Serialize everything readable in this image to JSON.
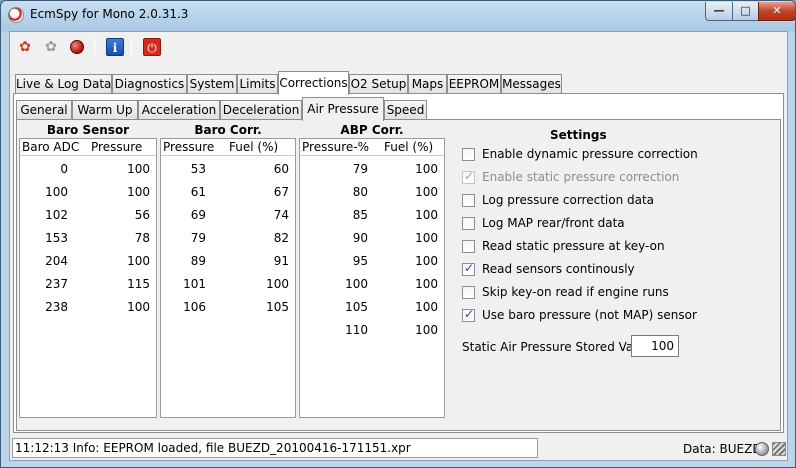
{
  "window": {
    "title": "EcmSpy for Mono 2.0.31.3"
  },
  "toolbar": {
    "buttons": [
      {
        "name": "connect-icon"
      },
      {
        "name": "disconnect-icon"
      },
      {
        "name": "stop-icon"
      },
      {
        "name": "info-icon",
        "glyph": "i"
      },
      {
        "name": "power-icon",
        "glyph": "⏻"
      }
    ]
  },
  "main_tabs": [
    "Live & Log Data",
    "Diagnostics",
    "System",
    "Limits",
    "Corrections",
    "O2 Setup",
    "Maps",
    "EEPROM",
    "Messages"
  ],
  "main_tab_active": "Corrections",
  "sub_tabs": [
    "General",
    "Warm Up",
    "Acceleration",
    "Deceleration",
    "Air Pressure",
    "Speed"
  ],
  "sub_tab_active": "Air Pressure",
  "baro_sensor": {
    "title": "Baro Sensor",
    "col1": "Baro ADC",
    "col2": "Pressure",
    "rows": [
      [
        "0",
        "100"
      ],
      [
        "100",
        "100"
      ],
      [
        "102",
        "56"
      ],
      [
        "153",
        "78"
      ],
      [
        "204",
        "100"
      ],
      [
        "237",
        "115"
      ],
      [
        "238",
        "100"
      ]
    ]
  },
  "baro_corr": {
    "title": "Baro Corr.",
    "col1": "Pressure",
    "col2": "Fuel (%)",
    "rows": [
      [
        "53",
        "60"
      ],
      [
        "61",
        "67"
      ],
      [
        "69",
        "74"
      ],
      [
        "79",
        "82"
      ],
      [
        "89",
        "91"
      ],
      [
        "101",
        "100"
      ],
      [
        "106",
        "105"
      ]
    ]
  },
  "abp_corr": {
    "title": "ABP Corr.",
    "col1": "Pressure-%",
    "col2": "Fuel (%)",
    "rows": [
      [
        "79",
        "100"
      ],
      [
        "80",
        "100"
      ],
      [
        "85",
        "100"
      ],
      [
        "90",
        "100"
      ],
      [
        "95",
        "100"
      ],
      [
        "100",
        "100"
      ],
      [
        "105",
        "100"
      ],
      [
        "110",
        "100"
      ]
    ]
  },
  "settings": {
    "title": "Settings",
    "options": [
      {
        "label": "Enable dynamic pressure correction",
        "checked": false,
        "disabled": false
      },
      {
        "label": "Enable static pressure correction",
        "checked": true,
        "disabled": true
      },
      {
        "label": "Log pressure correction data",
        "checked": false,
        "disabled": false
      },
      {
        "label": "Log MAP rear/front data",
        "checked": false,
        "disabled": false
      },
      {
        "label": "Read static pressure at key-on",
        "checked": false,
        "disabled": false
      },
      {
        "label": "Read sensors continously",
        "checked": true,
        "disabled": false
      },
      {
        "label": "Skip key-on read if engine runs",
        "checked": false,
        "disabled": false
      },
      {
        "label": "Use baro pressure (not MAP) sensor",
        "checked": true,
        "disabled": false
      }
    ],
    "stored_value_label": "Static Air Pressure Stored Value",
    "stored_value": "100"
  },
  "status": {
    "message": "11:12:13 Info: EEPROM loaded, file BUEZD_20100416-171151.xpr",
    "data_label": "Data: BUEZD"
  }
}
